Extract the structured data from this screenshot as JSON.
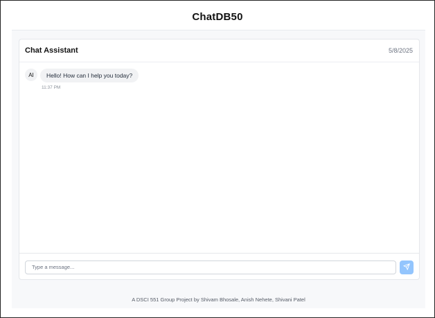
{
  "app": {
    "title": "ChatDB50"
  },
  "chat": {
    "title": "Chat Assistant",
    "date": "5/8/2025",
    "messages": [
      {
        "sender": "AI",
        "text": "Hello! How can I help you today?",
        "time": "11:37 PM"
      }
    ]
  },
  "composer": {
    "placeholder": "Type a message...",
    "send_icon": "send-icon"
  },
  "footer": {
    "text": "A DSCI 551 Group Project by Shivam Bhosale, Anish Nehete, Shivani Patel"
  },
  "colors": {
    "send_button": "#93c5fd",
    "page_bg": "#f7f8fa",
    "bubble": "#f1f2f4"
  }
}
